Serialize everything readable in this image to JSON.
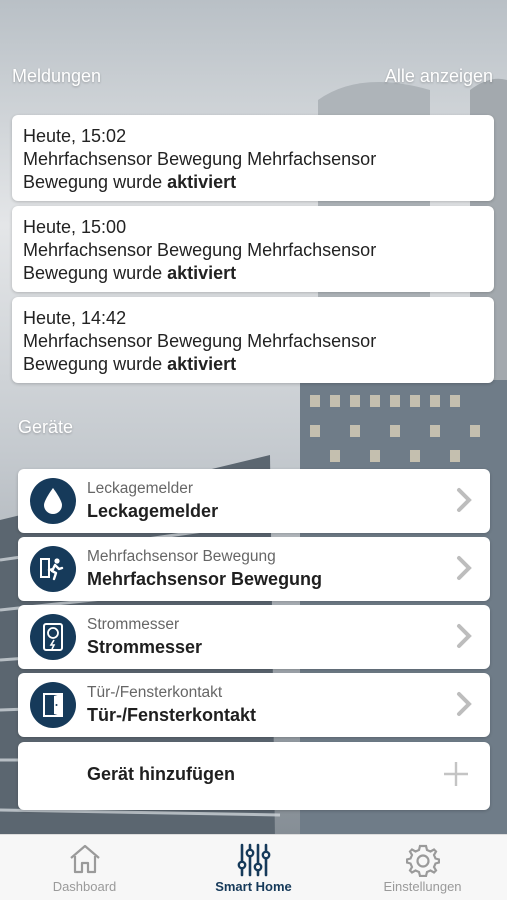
{
  "messages": {
    "title": "Meldungen",
    "show_all": "Alle anzeigen",
    "items": [
      {
        "time": "Heute, 15:02",
        "line2": "Mehrfachsensor Bewegung Mehrfachsensor",
        "line3": "Bewegung wurde ",
        "status": "aktiviert"
      },
      {
        "time": "Heute, 15:00",
        "line2": "Mehrfachsensor Bewegung Mehrfachsensor",
        "line3": "Bewegung wurde ",
        "status": "aktiviert"
      },
      {
        "time": "Heute, 14:42",
        "line2": "Mehrfachsensor Bewegung Mehrfachsensor",
        "line3": "Bewegung wurde ",
        "status": "aktiviert"
      }
    ]
  },
  "devices": {
    "title": "Geräte",
    "items": [
      {
        "type": "Leckagemelder",
        "name": "Leckagemelder",
        "icon": "water-drop-icon"
      },
      {
        "type": "Mehrfachsensor Bewegung",
        "name": "Mehrfachsensor Bewegung",
        "icon": "running-person-icon"
      },
      {
        "type": "Strommesser",
        "name": "Strommesser",
        "icon": "power-meter-icon"
      },
      {
        "type": "Tür-/Fensterkontakt",
        "name": "Tür-/Fensterkontakt",
        "icon": "door-icon"
      }
    ],
    "add_label": "Gerät hinzufügen"
  },
  "tabbar": {
    "tabs": [
      {
        "label": "Dashboard",
        "icon": "house-icon",
        "active": false
      },
      {
        "label": "Smart Home",
        "icon": "sliders-icon",
        "active": true
      },
      {
        "label": "Einstellungen",
        "icon": "gear-icon",
        "active": false
      }
    ]
  },
  "colors": {
    "accent": "#163a5a",
    "inactive": "#9a9a9a"
  }
}
